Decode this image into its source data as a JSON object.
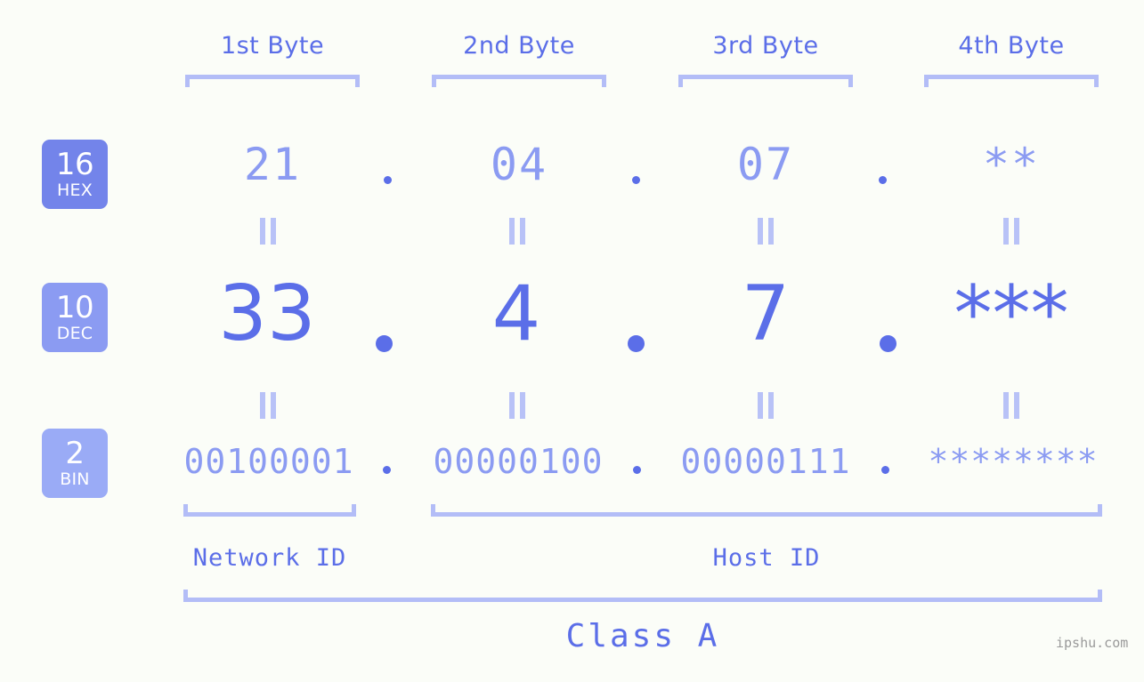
{
  "page": {
    "background_color": "#fbfdf8",
    "accent_strong": "#5b6ee8",
    "accent_light": "#8b9bf2",
    "accent_pale": "#b3bdf7",
    "watermark": "ipshu.com"
  },
  "byte_headers": [
    {
      "label": "1st Byte"
    },
    {
      "label": "2nd Byte"
    },
    {
      "label": "3rd Byte"
    },
    {
      "label": "4th Byte"
    }
  ],
  "bases": [
    {
      "number": "16",
      "name": "HEX",
      "color": "#7384ea"
    },
    {
      "number": "10",
      "name": "DEC",
      "color": "#8b9bf2"
    },
    {
      "number": "2",
      "name": "BIN",
      "color": "#9aabf6"
    }
  ],
  "rows": {
    "hex": {
      "values": [
        "21",
        "04",
        "07",
        "**"
      ]
    },
    "dec": {
      "values": [
        "33",
        "4",
        "7",
        "***"
      ]
    },
    "bin": {
      "values": [
        "00100001",
        "00000100",
        "00000111",
        "********"
      ]
    }
  },
  "separator": ".",
  "equals_symbol": "=",
  "segments": {
    "network_id": "Network ID",
    "host_id": "Host ID",
    "class": "Class A"
  }
}
